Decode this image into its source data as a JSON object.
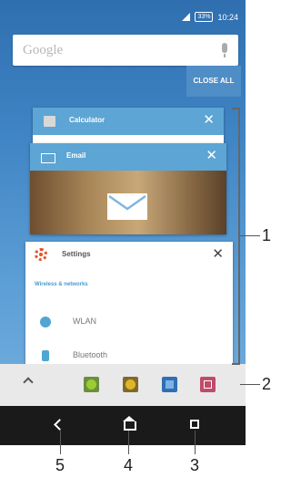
{
  "status_bar": {
    "battery": "33%",
    "time": "10:24"
  },
  "search": {
    "placeholder": "Google"
  },
  "actions": {
    "close_all": "CLOSE ALL"
  },
  "recent_apps": [
    {
      "title": "Calculator",
      "close": "✕"
    },
    {
      "title": "Email",
      "close": "✕"
    },
    {
      "title": "Settings",
      "close": "✕",
      "section": "Wireless & networks",
      "items": [
        {
          "label": "WLAN"
        },
        {
          "label": "Bluetooth"
        }
      ]
    }
  ],
  "callouts": {
    "recents_list": "1",
    "small_apps": "2",
    "recent_button": "3",
    "home_button": "4",
    "back_button": "5"
  },
  "colors": {
    "accent": "#5da5d5",
    "wallpaper": "#3f84c4",
    "navbar": "#1a1a1a"
  }
}
